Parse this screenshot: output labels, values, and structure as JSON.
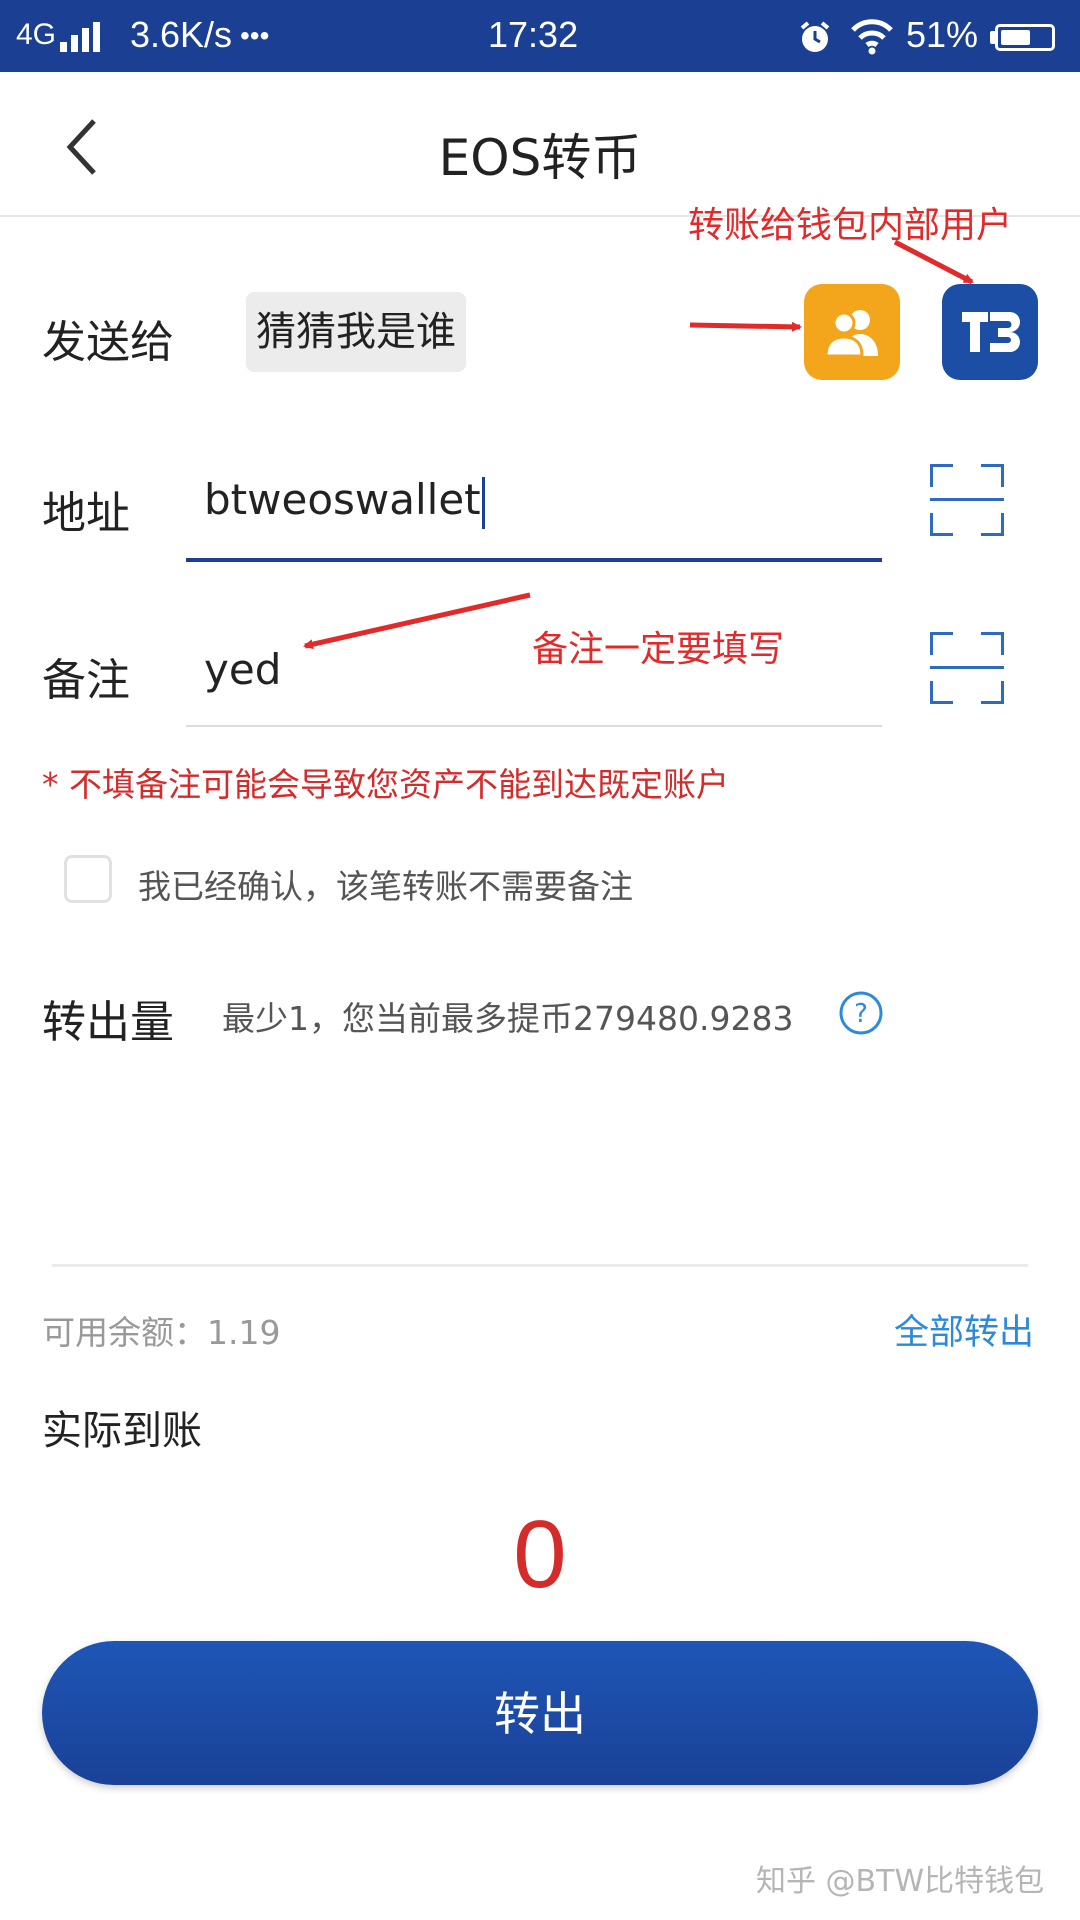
{
  "status_bar": {
    "network": "4G",
    "speed": "3.6K/s",
    "dots": "•••",
    "time": "17:32",
    "battery": "51%",
    "icons": [
      "signal-icon",
      "alarm-icon",
      "wifi-icon",
      "battery-icon"
    ]
  },
  "header": {
    "title": "EOS转币",
    "back_icon": "chevron-left-icon"
  },
  "form": {
    "send_to": {
      "label": "发送给",
      "value": "猜猜我是谁"
    },
    "address": {
      "label": "地址",
      "value": "btweoswallet"
    },
    "memo": {
      "label": "备注",
      "value": "yed"
    },
    "warning": "* 不填备注可能会导致您资产不能到达既定账户",
    "confirm_checkbox": {
      "label": "我已经确认，该笔转账不需要备注",
      "checked": false
    },
    "amount": {
      "label": "转出量",
      "hint": "最少1，您当前最多提币279480.9283"
    },
    "balance": {
      "label": "可用余额：1.19",
      "transfer_all": "全部转出"
    },
    "actual_received": {
      "label": "实际到账",
      "value": "0"
    }
  },
  "annotations": {
    "internal_user": "转账给钱包内部用户",
    "memo_required": "备注一定要填写"
  },
  "submit_button": {
    "label": "转出"
  },
  "watermark": "知乎 @BTW比特钱包",
  "colors": {
    "primary": "#1a3f93",
    "accent_blue": "#2c8ad8",
    "annotation_red": "#e12a2a",
    "contact_icon_bg": "#f3a51c",
    "value_red": "#d42b2b"
  }
}
